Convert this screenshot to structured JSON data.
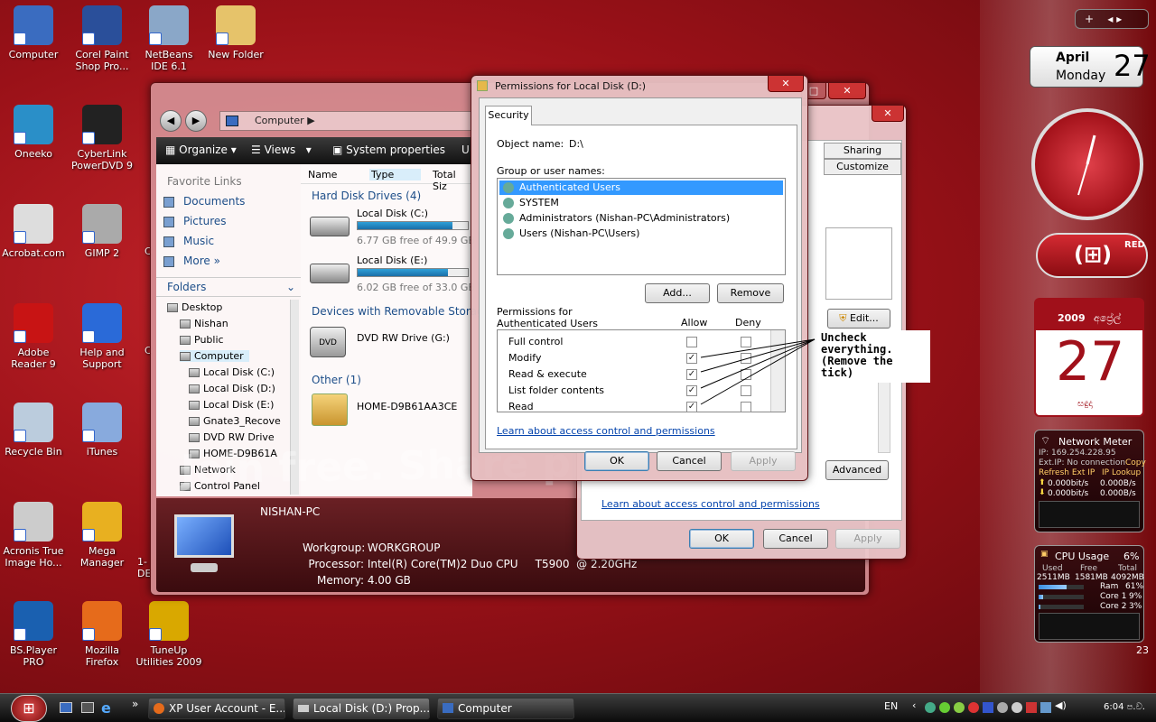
{
  "desktop": {
    "icons": [
      {
        "label": "Computer",
        "name": "computer"
      },
      {
        "label": "Corel Paint Shop Pro...",
        "name": "corel-paint-shop-pro"
      },
      {
        "label": "NetBeans IDE 6.1",
        "name": "netbeans-ide"
      },
      {
        "label": "New Folder",
        "name": "new-folder"
      },
      {
        "label": "Oneeko",
        "name": "oneeko"
      },
      {
        "label": "CyberLink PowerDVD 9",
        "name": "cyberlink-powerdvd"
      },
      {
        "label": "Acrobat.com",
        "name": "acrobat-com"
      },
      {
        "label": "GIMP 2",
        "name": "gimp"
      },
      {
        "label": "Adobe Reader 9",
        "name": "adobe-reader"
      },
      {
        "label": "Help and Support",
        "name": "help-and-support"
      },
      {
        "label": "Recycle Bin",
        "name": "recycle-bin"
      },
      {
        "label": "iTunes",
        "name": "itunes"
      },
      {
        "label": "Acronis True Image Ho...",
        "name": "acronis-true-image"
      },
      {
        "label": "Mega Manager",
        "name": "mega-manager"
      },
      {
        "label": "BS.Player PRO",
        "name": "bsplayer-pro"
      },
      {
        "label": "Mozilla Firefox",
        "name": "mozilla-firefox"
      },
      {
        "label": "TuneUp Utilities 2009",
        "name": "tuneup-utilities"
      }
    ],
    "partial_texts": {
      "c1": "C",
      "c2": "C",
      "c3": "1-",
      "c4": "DE"
    }
  },
  "explorer": {
    "address": "Computer",
    "toolbar": {
      "organize": "Organize",
      "views": "Views",
      "system_properties": "System properties",
      "u": "U"
    },
    "favorite_links_title": "Favorite Links",
    "favorite_links": [
      "Documents",
      "Pictures",
      "Music",
      "More"
    ],
    "folders_title": "Folders",
    "tree": [
      "Desktop",
      "Nishan",
      "Public",
      "Computer",
      "Local Disk (C:)",
      "Local Disk (D:)",
      "Local Disk (E:)",
      "Gnate3_Recove",
      "DVD RW Drive",
      "HOME-D9B61A",
      "Network",
      "Control Panel"
    ],
    "columns": [
      "Name",
      "Type",
      "Total Siz"
    ],
    "groups": {
      "hdd": "Hard Disk Drives (4)",
      "removable": "Devices with Removable Storage",
      "other": "Other (1)"
    },
    "drives": [
      {
        "name": "Local Disk (C:)",
        "free": "6.77 GB free of 49.9 GB",
        "used_fraction": 0.86
      },
      {
        "name": "Local Disk (E:)",
        "free": "6.02 GB free of 33.0 GB",
        "used_fraction": 0.82
      }
    ],
    "dvd": "DVD RW Drive (G:)",
    "other_item": "HOME-D9B61AA3CE",
    "details": {
      "pc_name": "NISHAN-PC",
      "workgroup_label": "Workgroup:",
      "workgroup": "WORKGROUP",
      "processor_label": "Processor:",
      "processor": "Intel(R) Core(TM)2 Duo CPU     T5900  @ 2.20GHz",
      "memory_label": "Memory:",
      "memory": "4.00 GB"
    }
  },
  "properties": {
    "tabs": [
      "Sharing",
      "Customize"
    ],
    "edit": "Edit...",
    "advanced": "Advanced",
    "link": "Learn about access control and permissions",
    "ok": "OK",
    "cancel": "Cancel",
    "apply": "Apply"
  },
  "permissions": {
    "title": "Permissions for Local Disk (D:)",
    "tab": "Security",
    "object_label": "Object name:",
    "object": "D:\\",
    "group_label": "Group or user names:",
    "users": [
      "Authenticated Users",
      "SYSTEM",
      "Administrators (Nishan-PC\\Administrators)",
      "Users (Nishan-PC\\Users)"
    ],
    "add": "Add...",
    "remove": "Remove",
    "perm_label": "Permissions for Authenticated Users",
    "allow": "Allow",
    "deny": "Deny",
    "rows": [
      {
        "name": "Full control",
        "allow": false
      },
      {
        "name": "Modify",
        "allow": true
      },
      {
        "name": "Read & execute",
        "allow": true
      },
      {
        "name": "List folder contents",
        "allow": true
      },
      {
        "name": "Read",
        "allow": true
      }
    ],
    "link": "Learn about access control and permissions",
    "ok": "OK",
    "cancel": "Cancel",
    "apply": "Apply"
  },
  "annotation": "Uncheck everything. (Remove the tick)",
  "watermark": "Join free. Share privately",
  "gadgets": {
    "calendar_month": "April",
    "calendar_day": "Monday",
    "calendar_date": "27",
    "red_label": "RED",
    "big_calendar_year": "2009",
    "big_calendar_month": "අප්‍රේල්",
    "big_calendar_date": "27",
    "big_calendar_weekday": "සඳුදා",
    "network": {
      "title": "Network Meter",
      "ip": "IP: 169.254.228.95",
      "ext_ip": "Ext.IP: No connection",
      "copy": "Copy",
      "refresh": "Refresh Ext IP",
      "lookup": "IP Lookup",
      "up1": "0.000bit/s",
      "up2": "0.000B/s",
      "down1": "0.000bit/s",
      "down2": "0.000B/s"
    },
    "cpu": {
      "title": "CPU Usage",
      "percent": "6%",
      "used_label": "Used",
      "free_label": "Free",
      "total_label": "Total",
      "used": "2511MB",
      "free": "1581MB",
      "total": "4092MB",
      "ram_label": "Ram",
      "ram": "61%",
      "core1_label": "Core 1",
      "core1": "9%",
      "core2_label": "Core 2",
      "core2": "3%",
      "ram_fraction": 0.61,
      "core1_fraction": 0.09,
      "core2_fraction": 0.03
    },
    "tray_count": "23"
  },
  "taskbar": {
    "items": [
      "XP User Account - E...",
      "Local Disk (D:) Prop...",
      "Computer"
    ],
    "lang": "EN",
    "time": "6:04 ප.ව.",
    "more": "»"
  }
}
